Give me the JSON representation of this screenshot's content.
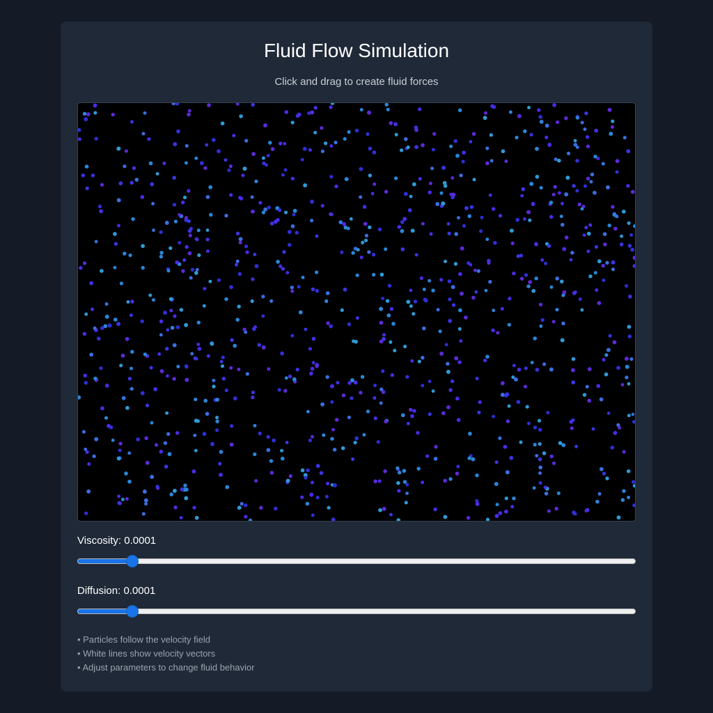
{
  "page": {
    "title": "Fluid Flow Simulation",
    "subtitle": "Click and drag to create fluid forces"
  },
  "controls": {
    "viscosity": {
      "label_prefix": "Viscosity: ",
      "value": "0.0001",
      "level": 0.0985
    },
    "diffusion": {
      "label_prefix": "Diffusion: ",
      "value": "0.0001",
      "level": 0.0985
    }
  },
  "notes": [
    "• Particles follow the velocity field",
    "• White lines show velocity vectors",
    "• Adjust parameters to change fluid behavior"
  ],
  "colors": {
    "page_bg": "#141a26",
    "panel_bg": "#1f2937",
    "canvas_bg": "#000000",
    "slider_accent": "#1a73e8",
    "particle_palette": [
      "#2f2fd6",
      "#3b34e0",
      "#4a2be6",
      "#5c2ad9",
      "#2a86d8",
      "#2f9ad6",
      "#3a6fe0"
    ]
  }
}
